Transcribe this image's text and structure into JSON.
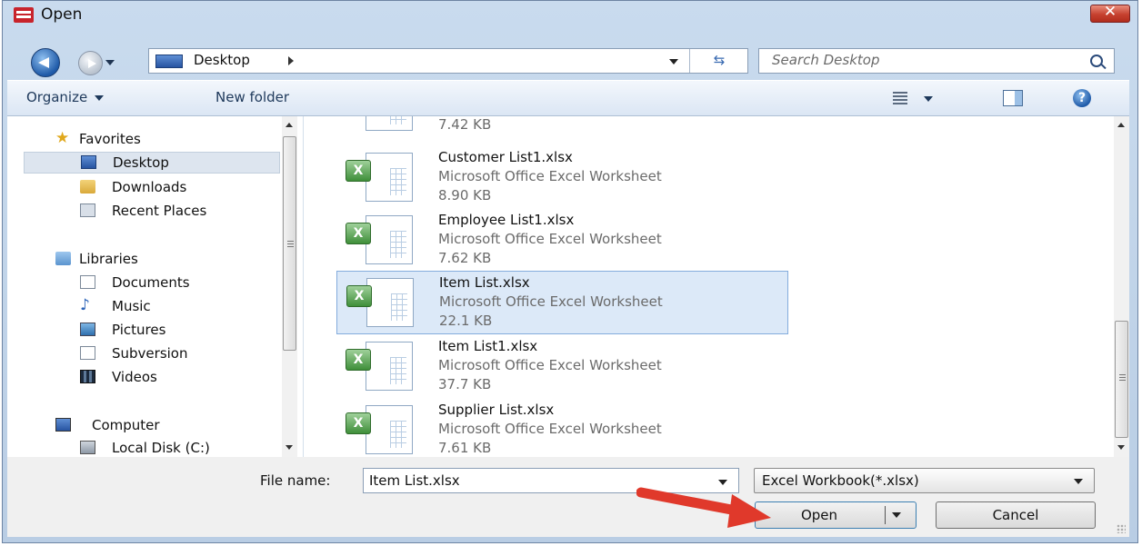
{
  "window": {
    "title": "Open"
  },
  "address": {
    "location": "Desktop"
  },
  "search": {
    "placeholder": "Search Desktop"
  },
  "toolbar": {
    "organize_label": "Organize",
    "new_folder_label": "New folder"
  },
  "nav": {
    "favorites": "Favorites",
    "desktop": "Desktop",
    "downloads": "Downloads",
    "recent": "Recent Places",
    "libraries": "Libraries",
    "documents": "Documents",
    "music": "Music",
    "pictures": "Pictures",
    "subversion": "Subversion",
    "videos": "Videos",
    "computer": "Computer",
    "local_disk": "Local Disk (C:)"
  },
  "files": [
    {
      "size": "7.42 KB"
    },
    {
      "name": "Customer List1.xlsx",
      "type": "Microsoft Office Excel Worksheet",
      "size": "8.90 KB"
    },
    {
      "name": "Employee List1.xlsx",
      "type": "Microsoft Office Excel Worksheet",
      "size": "7.62 KB"
    },
    {
      "name": "Item List.xlsx",
      "type": "Microsoft Office Excel Worksheet",
      "size": "22.1 KB",
      "selected": true
    },
    {
      "name": "Item List1.xlsx",
      "type": "Microsoft Office Excel Worksheet",
      "size": "37.7 KB"
    },
    {
      "name": "Supplier List.xlsx",
      "type": "Microsoft Office Excel Worksheet",
      "size": "7.61 KB"
    }
  ],
  "footer": {
    "file_name_label": "File name:",
    "file_name_value": "Item List.xlsx",
    "file_type": "Excel Workbook(*.xlsx)",
    "open_label": "Open",
    "cancel_label": "Cancel"
  },
  "colors": {
    "selection": "#dce9f8",
    "arrow": "#e0392b",
    "close_button": "#c6412f"
  }
}
